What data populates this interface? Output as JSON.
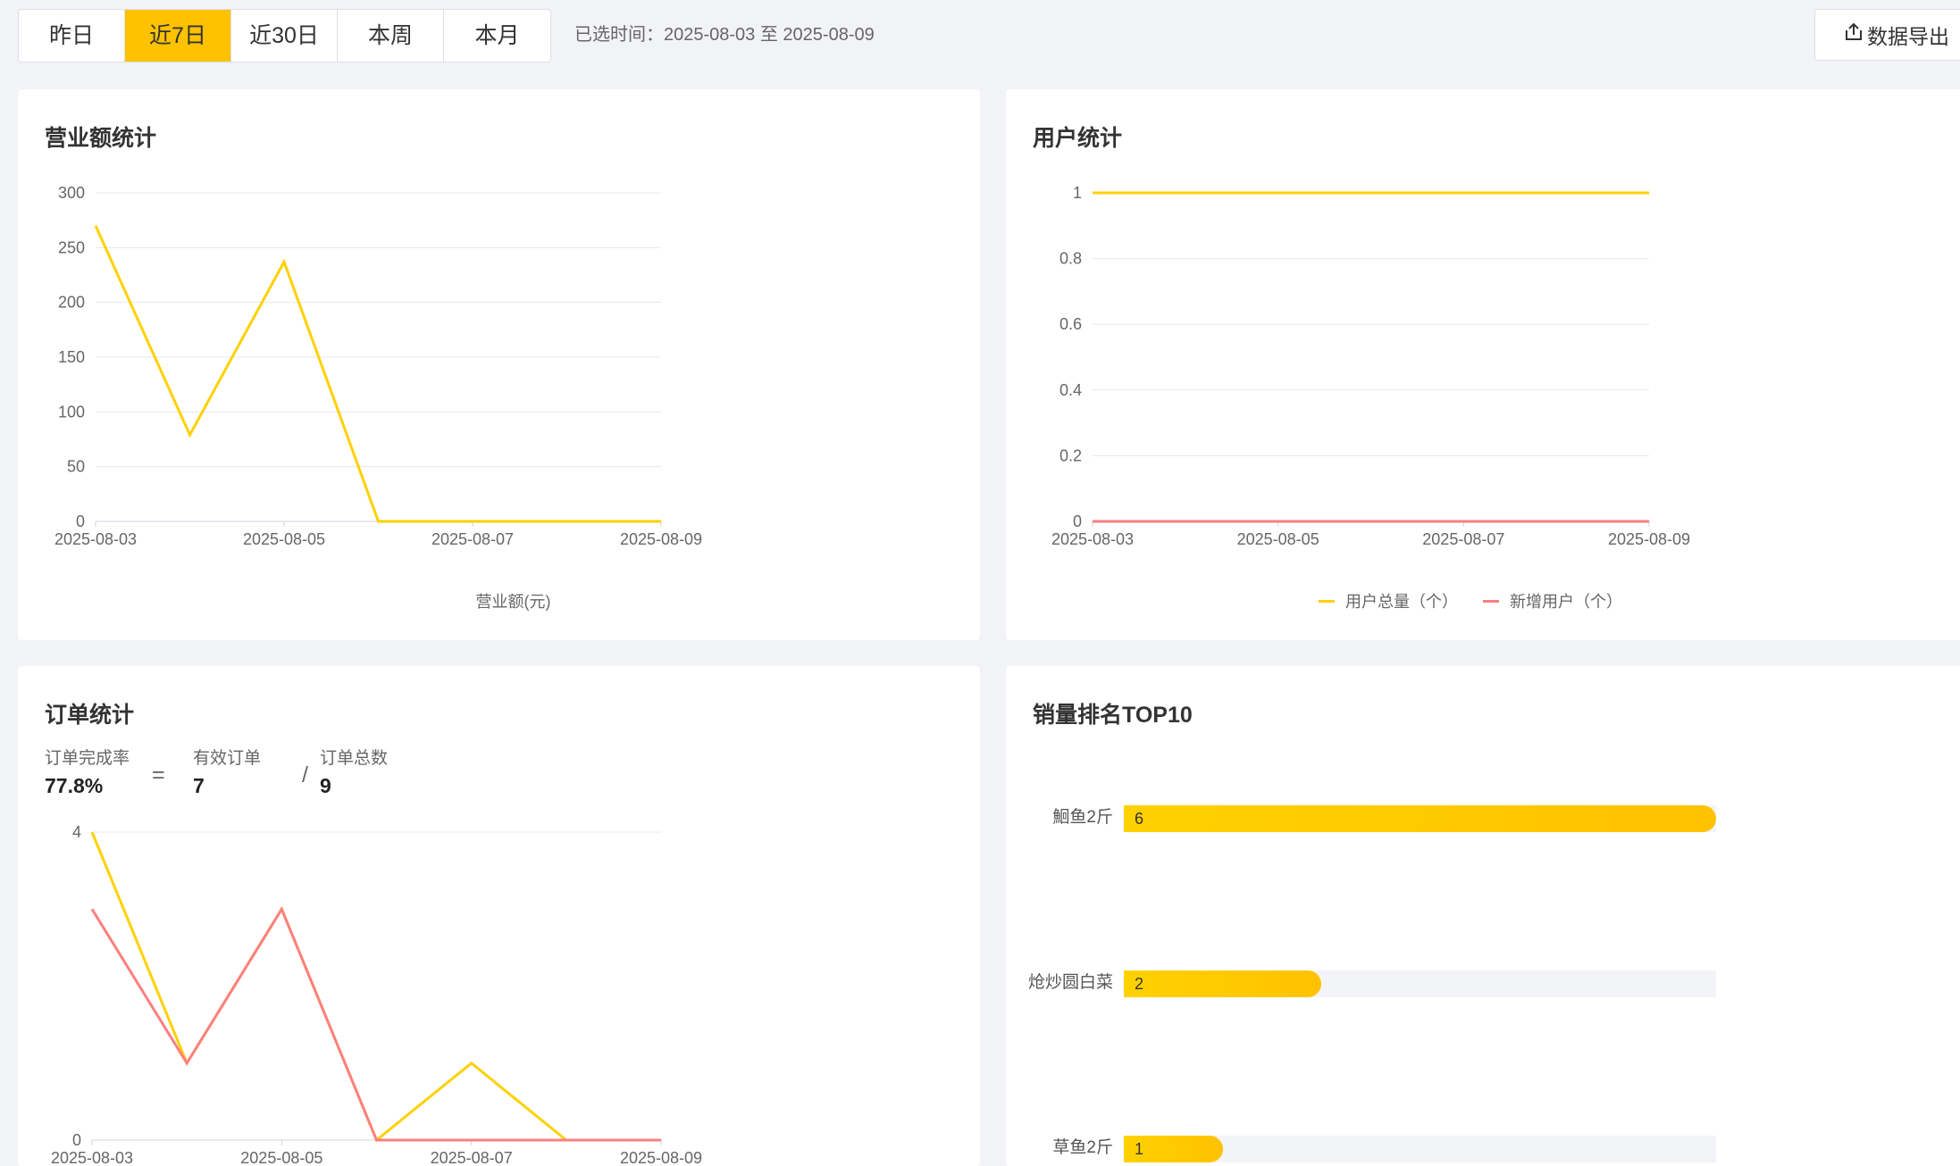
{
  "toolbar": {
    "range_tabs": [
      {
        "label": "昨日",
        "active": false
      },
      {
        "label": "近7日",
        "active": true
      },
      {
        "label": "近30日",
        "active": false
      },
      {
        "label": "本周",
        "active": false
      },
      {
        "label": "本月",
        "active": false
      }
    ],
    "selected_range_text": "已选时间：2025-08-03 至 2025-08-09",
    "export_label": "数据导出",
    "export_icon": "export-icon",
    "accent_color": "#ffc200"
  },
  "revenue_card": {
    "title": "营业额统计",
    "legend_label": "营业额(元)"
  },
  "users_card": {
    "title": "用户统计",
    "legend": [
      {
        "label": "用户总量（个）",
        "color": "#ffd100"
      },
      {
        "label": "新增用户（个）",
        "color": "#fd7f7f"
      }
    ]
  },
  "orders_card": {
    "title": "订单统计",
    "metrics": {
      "completion_rate_label": "订单完成率",
      "completion_rate_value": "77.8%",
      "equals": "=",
      "valid_label": "有效订单",
      "valid_value": "7",
      "divide": "/",
      "total_label": "订单总数",
      "total_value": "9"
    }
  },
  "ranking_card": {
    "title": "销量排名TOP10",
    "items": [
      {
        "name": "鮰鱼2斤",
        "value": "6",
        "ratio": 1.0
      },
      {
        "name": "炝炒圆白菜",
        "value": "2",
        "ratio": 0.333
      },
      {
        "name": "草鱼2斤",
        "value": "1",
        "ratio": 0.167
      }
    ]
  },
  "chart_data": [
    {
      "type": "line",
      "title": "营业额统计",
      "x": [
        "2025-08-03",
        "2025-08-04",
        "2025-08-05",
        "2025-08-06",
        "2025-08-07",
        "2025-08-08",
        "2025-08-09"
      ],
      "x_tick_labels": [
        "2025-08-03",
        "2025-08-05",
        "2025-08-07",
        "2025-08-09"
      ],
      "series": [
        {
          "name": "营业额(元)",
          "color": "#ffd100",
          "values": [
            270,
            79,
            237,
            0,
            0,
            0,
            0
          ]
        }
      ],
      "ylim": [
        0,
        300
      ],
      "y_ticks": [
        "0",
        "50",
        "100",
        "150",
        "200",
        "250",
        "300"
      ],
      "grid": true,
      "legend_position": "bottom"
    },
    {
      "type": "line",
      "title": "用户统计",
      "x": [
        "2025-08-03",
        "2025-08-04",
        "2025-08-05",
        "2025-08-06",
        "2025-08-07",
        "2025-08-08",
        "2025-08-09"
      ],
      "x_tick_labels": [
        "2025-08-03",
        "2025-08-05",
        "2025-08-07",
        "2025-08-09"
      ],
      "series": [
        {
          "name": "用户总量（个）",
          "color": "#ffd100",
          "values": [
            1,
            1,
            1,
            1,
            1,
            1,
            1
          ]
        },
        {
          "name": "新增用户（个）",
          "color": "#fd7f7f",
          "values": [
            0,
            0,
            0,
            0,
            0,
            0,
            0
          ]
        }
      ],
      "ylim": [
        0,
        1
      ],
      "y_ticks": [
        "0",
        "0.2",
        "0.4",
        "0.6",
        "0.8",
        "1"
      ],
      "grid": true,
      "legend_position": "bottom"
    },
    {
      "type": "line",
      "title": "订单统计",
      "x": [
        "2025-08-03",
        "2025-08-04",
        "2025-08-05",
        "2025-08-06",
        "2025-08-07",
        "2025-08-08",
        "2025-08-09"
      ],
      "x_tick_labels": [
        "2025-08-03",
        "2025-08-05",
        "2025-08-07",
        "2025-08-09"
      ],
      "series": [
        {
          "color": "#ffd100",
          "values": [
            4,
            1,
            3,
            0,
            1,
            0,
            0
          ]
        },
        {
          "color": "#fd7f7f",
          "values": [
            3,
            1,
            3,
            0,
            0,
            0,
            0
          ]
        }
      ],
      "ylim": [
        0,
        4
      ],
      "y_ticks": [
        "0",
        "4"
      ],
      "grid": true
    },
    {
      "type": "bar",
      "title": "销量排名TOP10",
      "orientation": "horizontal",
      "categories": [
        "鮰鱼2斤",
        "炝炒圆白菜",
        "草鱼2斤"
      ],
      "values": [
        6,
        2,
        1
      ],
      "color": "#ffc200"
    }
  ]
}
